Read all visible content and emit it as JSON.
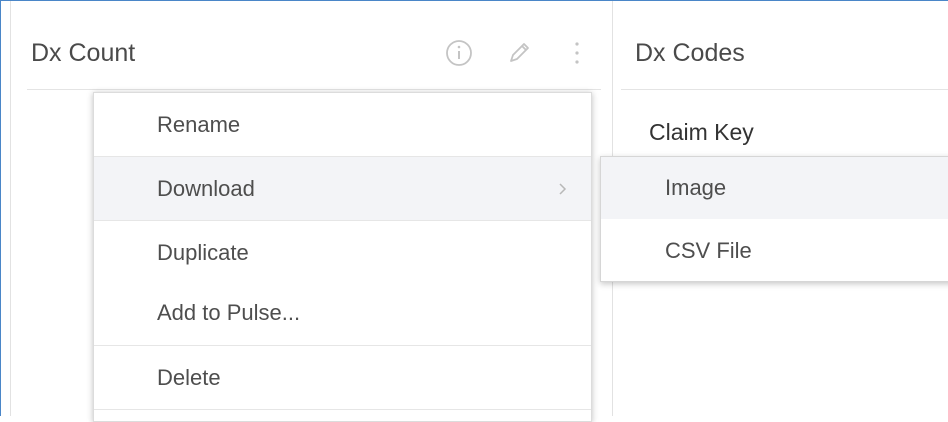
{
  "widgets": [
    {
      "title": "Dx Count",
      "icons": [
        "info-icon",
        "pencil-icon",
        "more-vertical-icon"
      ]
    },
    {
      "title": "Dx Codes",
      "column_header": "Claim Key"
    }
  ],
  "context_menu": {
    "items": [
      {
        "label": "Rename"
      },
      {
        "label": "Download",
        "has_submenu": true,
        "highlighted": true
      },
      {
        "label": "Duplicate"
      },
      {
        "label": "Add to Pulse..."
      },
      {
        "label": "Delete"
      }
    ]
  },
  "download_submenu": {
    "items": [
      {
        "label": "Image",
        "highlighted": true
      },
      {
        "label": "CSV File"
      }
    ]
  },
  "colors": {
    "frame_border": "#4a86c8",
    "highlight_bg": "#f3f4f7",
    "text": "#4e4e4e",
    "icon": "#c4c4c4"
  }
}
